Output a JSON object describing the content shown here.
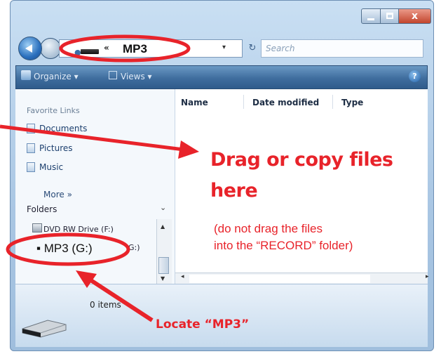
{
  "address_bar": {
    "current_folder": "MP3",
    "breadcrumb_chevron": "«",
    "dropdown_glyph": "▾",
    "refresh_glyph": "↻"
  },
  "search": {
    "placeholder": "Search"
  },
  "toolbar": {
    "organize_label": "Organize ▾",
    "views_label": "Views ▾",
    "help_glyph": "?"
  },
  "navigation_pane": {
    "favorite_links_title": "Favorite Links",
    "favorite_links": [
      "Documents",
      "Pictures",
      "Music"
    ],
    "more_label": "More »",
    "folders_title": "Folders",
    "folders_chevron": "⌄",
    "tree": {
      "dvd_drive": "DVD RW Drive (F:)",
      "mp3_drive": "MP3  (G:)",
      "mp3_drive_tail": "G:)"
    }
  },
  "file_list": {
    "columns": [
      "Name",
      "Date modified",
      "Type"
    ]
  },
  "details_pane": {
    "item_count": "0 items"
  },
  "annotations": {
    "drag_heading": "Drag or copy files here",
    "drag_note_line1": "(do not drag the files",
    "drag_note_line2": "into the “RECORD” folder)",
    "locate_label": "Locate “MP3”",
    "accent_color": "#e8232a"
  }
}
